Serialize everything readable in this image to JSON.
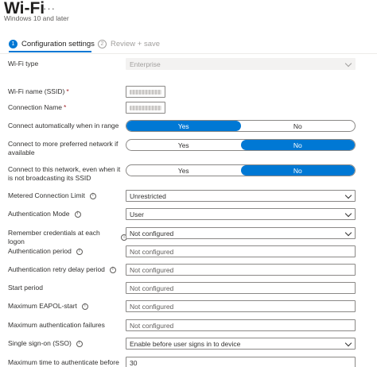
{
  "header": {
    "title": "Wi-Fi",
    "more": "···",
    "subtitle": "Windows 10 and later"
  },
  "steps": [
    {
      "num": "1",
      "label": "Configuration settings",
      "active": true
    },
    {
      "num": "2",
      "label": "Review + save",
      "active": false
    }
  ],
  "form": {
    "wifi_type": {
      "label": "Wi-Fi type",
      "value": "Enterprise"
    },
    "ssid": {
      "label": "Wi-Fi name (SSID)",
      "required": "*"
    },
    "connection_name": {
      "label": "Connection Name",
      "required": "*"
    },
    "connect_auto": {
      "label": "Connect automatically when in range",
      "yes": "Yes",
      "no": "No",
      "selected": "Yes"
    },
    "connect_preferred": {
      "label": "Connect to more preferred network if available",
      "yes": "Yes",
      "no": "No",
      "selected": "No"
    },
    "connect_hidden": {
      "label": "Connect to this network, even when it is not broadcasting its SSID",
      "yes": "Yes",
      "no": "No",
      "selected": "No"
    },
    "metered": {
      "label": "Metered Connection Limit",
      "value": "Unrestricted"
    },
    "auth_mode": {
      "label": "Authentication Mode",
      "value": "User"
    },
    "remember_creds": {
      "label": "Remember credentials at each logon",
      "value": "Not configured"
    },
    "auth_period": {
      "label": "Authentication period",
      "placeholder": "Not configured"
    },
    "auth_retry": {
      "label": "Authentication retry delay period",
      "placeholder": "Not configured"
    },
    "start_period": {
      "label": "Start period",
      "placeholder": "Not configured"
    },
    "max_eapol": {
      "label": "Maximum EAPOL-start",
      "placeholder": "Not configured"
    },
    "max_auth_fail": {
      "label": "Maximum authentication failures",
      "placeholder": "Not configured"
    },
    "sso": {
      "label": "Single sign-on (SSO)",
      "value": "Enable before user signs in to device"
    },
    "max_time": {
      "label": "Maximum time to authenticate before",
      "value": "30"
    }
  }
}
